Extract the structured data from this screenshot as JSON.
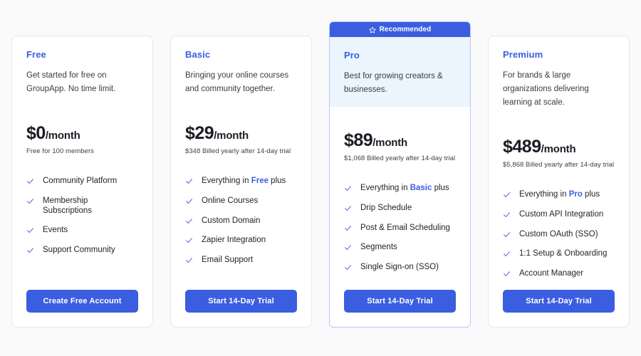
{
  "page": {
    "background_color": "#fafafa",
    "accent_color": "#3b5ee0",
    "featured_tint_color": "#eaf5fd"
  },
  "plans": [
    {
      "name": "Free",
      "blurb": "Get started for free on GroupApp. No time limit.",
      "price_amount": "$0",
      "price_period": "/month",
      "price_note": "Free for 100 members",
      "featured": false,
      "badge": null,
      "features": [
        {
          "pre": "Community Platform",
          "hl": "",
          "post": ""
        },
        {
          "pre": "Membership Subscriptions",
          "hl": "",
          "post": ""
        },
        {
          "pre": "Events",
          "hl": "",
          "post": ""
        },
        {
          "pre": "Support Community",
          "hl": "",
          "post": ""
        }
      ],
      "cta_label": "Create Free Account"
    },
    {
      "name": "Basic",
      "blurb": "Bringing your online courses and community together.",
      "price_amount": "$29",
      "price_period": "/month",
      "price_note": "$348 Billed yearly after 14-day trial",
      "featured": false,
      "badge": null,
      "features": [
        {
          "pre": "Everything in ",
          "hl": "Free",
          "post": " plus"
        },
        {
          "pre": "Online Courses",
          "hl": "",
          "post": ""
        },
        {
          "pre": "Custom Domain",
          "hl": "",
          "post": ""
        },
        {
          "pre": "Zapier Integration",
          "hl": "",
          "post": ""
        },
        {
          "pre": "Email Support",
          "hl": "",
          "post": ""
        }
      ],
      "cta_label": "Start 14-Day Trial"
    },
    {
      "name": "Pro",
      "blurb": "Best for growing creators & businesses.",
      "price_amount": "$89",
      "price_period": "/month",
      "price_note": "$1,068 Billed yearly after 14-day trial",
      "featured": true,
      "badge": "Recommended",
      "features": [
        {
          "pre": "Everything in ",
          "hl": "Basic",
          "post": " plus"
        },
        {
          "pre": "Drip Schedule",
          "hl": "",
          "post": ""
        },
        {
          "pre": "Post & Email Scheduling",
          "hl": "",
          "post": ""
        },
        {
          "pre": "Segments",
          "hl": "",
          "post": ""
        },
        {
          "pre": "Single Sign-on (SSO)",
          "hl": "",
          "post": ""
        }
      ],
      "cta_label": "Start 14-Day Trial"
    },
    {
      "name": "Premium",
      "blurb": "For brands & large organizations delivering learning at scale.",
      "price_amount": "$489",
      "price_period": "/month",
      "price_note": "$5,868 Billed yearly after 14-day trial",
      "featured": false,
      "badge": null,
      "features": [
        {
          "pre": "Everything in ",
          "hl": "Pro",
          "post": " plus"
        },
        {
          "pre": "Custom API Integration",
          "hl": "",
          "post": ""
        },
        {
          "pre": "Custom OAuth (SSO)",
          "hl": "",
          "post": ""
        },
        {
          "pre": "1:1 Setup & Onboarding",
          "hl": "",
          "post": ""
        },
        {
          "pre": "Account Manager",
          "hl": "",
          "post": ""
        }
      ],
      "cta_label": "Start 14-Day Trial"
    }
  ],
  "icons": {
    "star": "star-icon",
    "check": "check-icon"
  }
}
